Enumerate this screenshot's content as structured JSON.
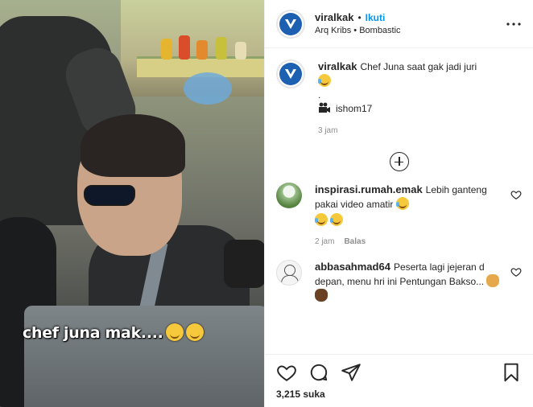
{
  "post": {
    "media": {
      "overlay_text": "chef juna mak....",
      "overlay_emojis": [
        "smiling-face-icon",
        "smiling-face-icon"
      ]
    },
    "header": {
      "username": "viralkak",
      "separator": "•",
      "follow_label": "Ikuti",
      "location": "Arq Kribs • Bombastic",
      "more_icon": "more-options-icon"
    },
    "caption": {
      "username": "viralkak",
      "line1": "Chef Juna saat gak jadi juri",
      "line2": ".",
      "credit": "ishom17",
      "time": "3 jam"
    },
    "load_more_icon": "plus-circle-icon",
    "comments": [
      {
        "username": "inspirasi.rumah.emak",
        "text": "Lebih ganteng pakai video amatir",
        "time": "2 jam",
        "reply_label": "Balas"
      },
      {
        "username": "abbasahmad64",
        "text": "Peserta lagi jejeran d depan, menu hri ini Pentungan Bakso..."
      }
    ],
    "actions": {
      "like_icon": "heart-icon",
      "comment_icon": "comment-icon",
      "share_icon": "share-icon",
      "save_icon": "bookmark-icon",
      "likes_text": "3,215 suka"
    },
    "colors": {
      "accent": "#0095f6",
      "text": "#262626",
      "muted": "#8e8e8e",
      "logo": "#1d60b2"
    }
  }
}
